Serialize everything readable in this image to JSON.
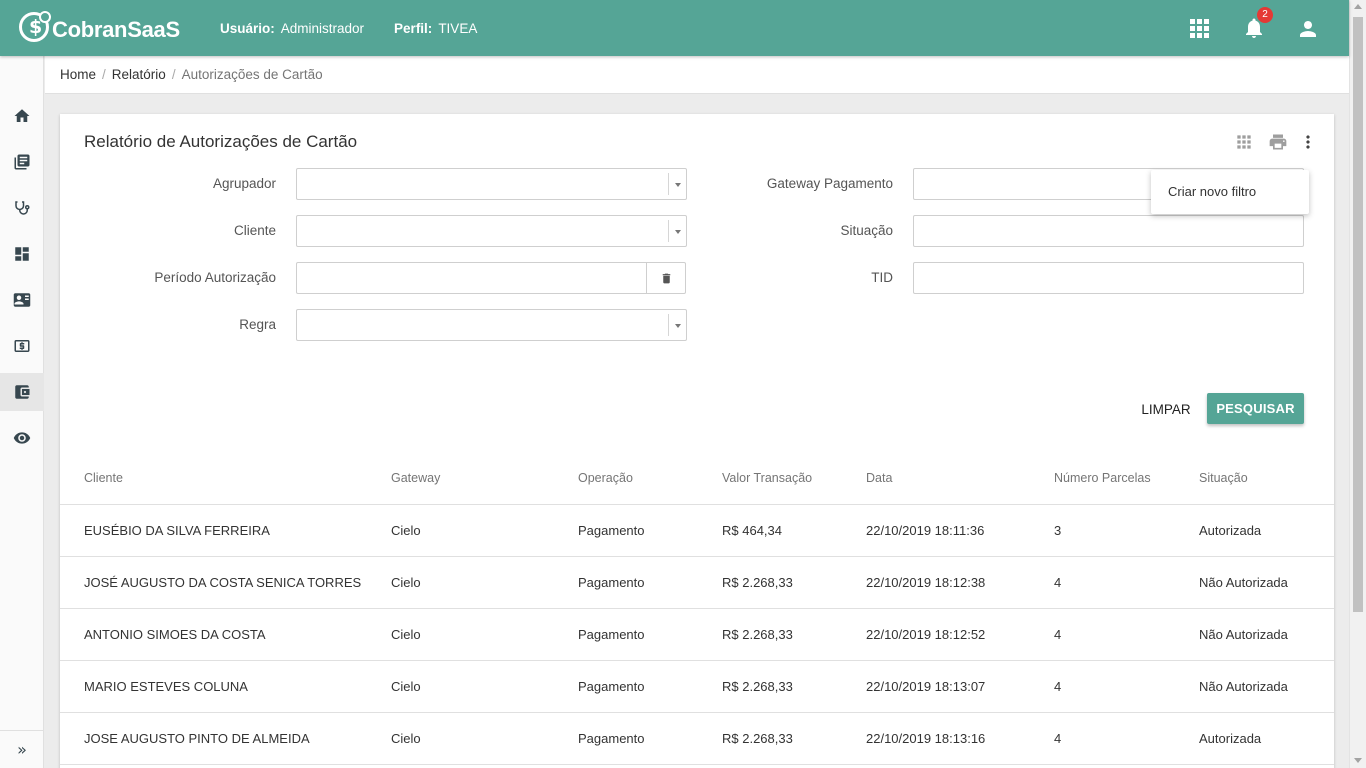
{
  "app": {
    "brand": "CobranSaaS"
  },
  "header": {
    "user_label": "Usuário:",
    "user_value": "Administrador",
    "profile_label": "Perfil:",
    "profile_value": "TIVEA",
    "notification_count": "2"
  },
  "sidebar": {
    "items": [
      {
        "icon": "home-icon"
      },
      {
        "icon": "book-icon"
      },
      {
        "icon": "stethoscope-icon"
      },
      {
        "icon": "dashboard-icon"
      },
      {
        "icon": "contact-card-icon"
      },
      {
        "icon": "money-icon"
      },
      {
        "icon": "wallet-icon",
        "active": true
      },
      {
        "icon": "eye-icon"
      }
    ],
    "expand_glyph": "»"
  },
  "breadcrumb": {
    "home": "Home",
    "report": "Relatório",
    "current": "Autorizações de Cartão",
    "separator": "/"
  },
  "page": {
    "title": "Relatório de Autorizações de Cartão"
  },
  "form": {
    "agrupador": "Agrupador",
    "cliente": "Cliente",
    "periodo": "Período Autorização",
    "regra": "Regra",
    "gateway": "Gateway Pagamento",
    "situacao": "Situação",
    "tid": "TID"
  },
  "actions": {
    "clear": "LIMPAR",
    "search": "PESQUISAR"
  },
  "menu": {
    "new_filter": "Criar novo filtro"
  },
  "table": {
    "columns": [
      "Cliente",
      "Gateway",
      "Operação",
      "Valor Transação",
      "Data",
      "Número Parcelas",
      "Situação"
    ],
    "rows": [
      [
        "EUSÉBIO DA SILVA FERREIRA",
        "Cielo",
        "Pagamento",
        "R$ 464,34",
        "22/10/2019 18:11:36",
        "3",
        "Autorizada"
      ],
      [
        "JOSÉ AUGUSTO DA COSTA SENICA TORRES",
        "Cielo",
        "Pagamento",
        "R$ 2.268,33",
        "22/10/2019 18:12:38",
        "4",
        "Não Autorizada"
      ],
      [
        "ANTONIO SIMOES DA COSTA",
        "Cielo",
        "Pagamento",
        "R$ 2.268,33",
        "22/10/2019 18:12:52",
        "4",
        "Não Autorizada"
      ],
      [
        "MARIO ESTEVES COLUNA",
        "Cielo",
        "Pagamento",
        "R$ 2.268,33",
        "22/10/2019 18:13:07",
        "4",
        "Não Autorizada"
      ],
      [
        "JOSE AUGUSTO PINTO DE ALMEIDA",
        "Cielo",
        "Pagamento",
        "R$ 2.268,33",
        "22/10/2019 18:13:16",
        "4",
        "Autorizada"
      ]
    ]
  },
  "colors": {
    "primary": "#55a596",
    "badge": "#e53935"
  }
}
